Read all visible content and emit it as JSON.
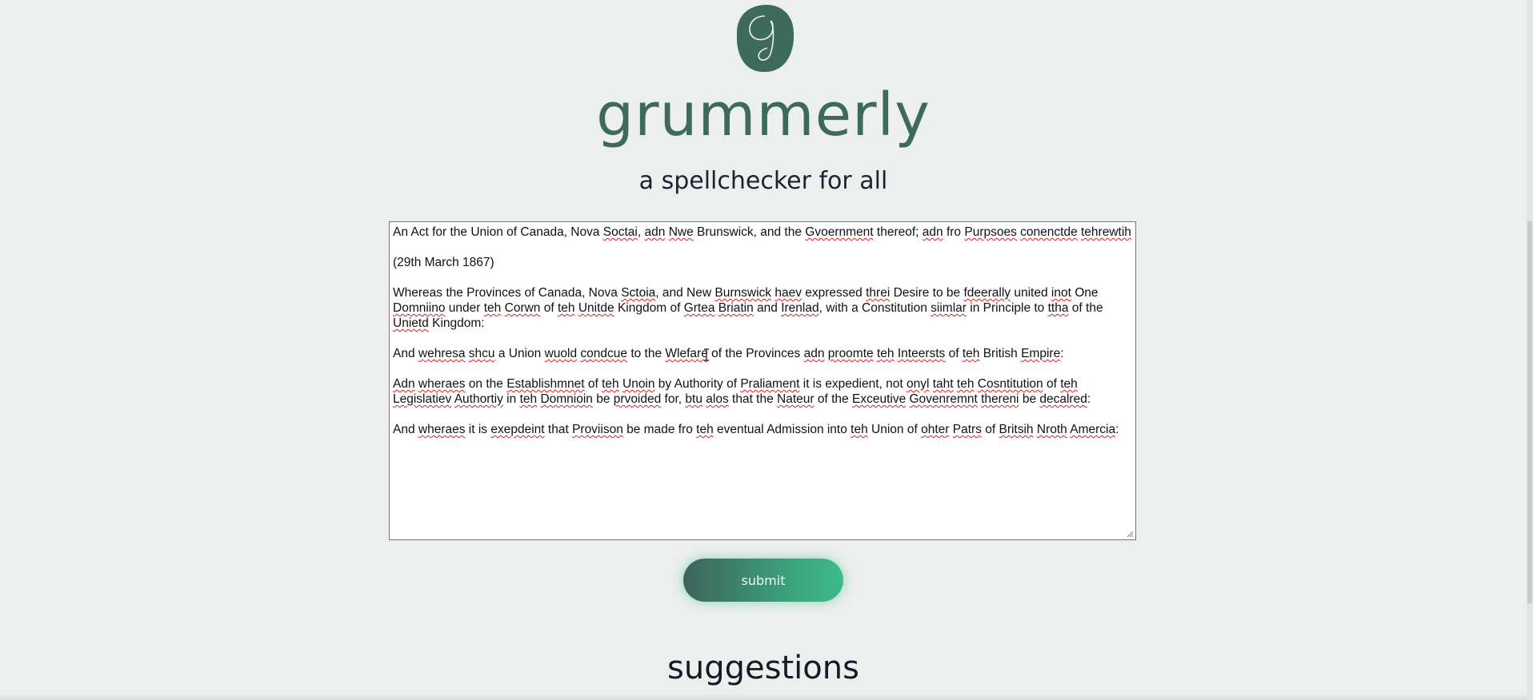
{
  "app": {
    "brand": "grummerly",
    "tagline": "a spellchecker for all",
    "colors": {
      "brand": "#3e6a5c",
      "accent": "#3dba8b",
      "background": "#ecefee",
      "misspelling": "#e01e1e"
    }
  },
  "editor": {
    "paragraphs": [
      [
        {
          "t": "An Act for the Union of Canada, Nova "
        },
        {
          "t": "Soctai",
          "err": true
        },
        {
          "t": ", "
        },
        {
          "t": "adn",
          "err": true
        },
        {
          "t": " "
        },
        {
          "t": "Nwe",
          "err": true
        },
        {
          "t": " Brunswick, and the "
        },
        {
          "t": "Gvoernment",
          "err": true
        },
        {
          "t": " thereof; "
        },
        {
          "t": "adn",
          "err": true
        },
        {
          "t": " fro "
        },
        {
          "t": "Purpsoes",
          "err": true
        },
        {
          "t": " "
        },
        {
          "t": "conenctde",
          "err": true
        },
        {
          "t": " "
        },
        {
          "t": "tehrewtih",
          "err": true
        }
      ],
      [
        {
          "t": "(29th March 1867)"
        }
      ],
      [
        {
          "t": "Whereas the Provinces of Canada, Nova "
        },
        {
          "t": "Sctoia",
          "err": true
        },
        {
          "t": ", and New "
        },
        {
          "t": "Burnswick",
          "err": true
        },
        {
          "t": " "
        },
        {
          "t": "haev",
          "err": true
        },
        {
          "t": " expressed "
        },
        {
          "t": "threi",
          "err": true
        },
        {
          "t": " Desire to be "
        },
        {
          "t": "fdeerally",
          "err": true
        },
        {
          "t": " united "
        },
        {
          "t": "inot",
          "err": true
        },
        {
          "t": " One "
        },
        {
          "t": "Domniino",
          "err": true
        },
        {
          "t": " under "
        },
        {
          "t": "teh",
          "err": true
        },
        {
          "t": " "
        },
        {
          "t": "Corwn",
          "err": true
        },
        {
          "t": " of "
        },
        {
          "t": "teh",
          "err": true
        },
        {
          "t": " "
        },
        {
          "t": "Unitde",
          "err": true
        },
        {
          "t": " Kingdom of "
        },
        {
          "t": "Grtea",
          "err": true
        },
        {
          "t": " "
        },
        {
          "t": "Briatin",
          "err": true
        },
        {
          "t": " and "
        },
        {
          "t": "Irenlad",
          "err": true
        },
        {
          "t": ", with a Constitution "
        },
        {
          "t": "siimlar",
          "err": true
        },
        {
          "t": " in Principle to "
        },
        {
          "t": "ttha",
          "err": true
        },
        {
          "t": " of the "
        },
        {
          "t": "Unietd",
          "err": true
        },
        {
          "t": " Kingdom:"
        }
      ],
      [
        {
          "t": "And "
        },
        {
          "t": "wehresa",
          "err": true
        },
        {
          "t": " "
        },
        {
          "t": "shcu",
          "err": true
        },
        {
          "t": " a Union "
        },
        {
          "t": "wuold",
          "err": true
        },
        {
          "t": " "
        },
        {
          "t": "condcue",
          "err": true
        },
        {
          "t": " to the "
        },
        {
          "t": "Wlefare",
          "err": true
        },
        {
          "t": " of the Provinces "
        },
        {
          "t": "adn",
          "err": true
        },
        {
          "t": " "
        },
        {
          "t": "proomte",
          "err": true
        },
        {
          "t": " "
        },
        {
          "t": "teh",
          "err": true
        },
        {
          "t": " "
        },
        {
          "t": "Inteersts",
          "err": true
        },
        {
          "t": " of "
        },
        {
          "t": "teh",
          "err": true
        },
        {
          "t": " British "
        },
        {
          "t": "Empire",
          "err": true
        },
        {
          "t": ":"
        }
      ],
      [
        {
          "t": "Adn",
          "err": true
        },
        {
          "t": " "
        },
        {
          "t": "wheraes",
          "err": true
        },
        {
          "t": " on the "
        },
        {
          "t": "Establishmnet",
          "err": true
        },
        {
          "t": " of "
        },
        {
          "t": "teh",
          "err": true
        },
        {
          "t": " "
        },
        {
          "t": "Unoin",
          "err": true
        },
        {
          "t": " by Authority of "
        },
        {
          "t": "Praliament",
          "err": true
        },
        {
          "t": " it is expedient, not "
        },
        {
          "t": "onyl",
          "err": true
        },
        {
          "t": " "
        },
        {
          "t": "taht",
          "err": true
        },
        {
          "t": " "
        },
        {
          "t": "teh",
          "err": true
        },
        {
          "t": " "
        },
        {
          "t": "Cosntitution",
          "err": true
        },
        {
          "t": " of "
        },
        {
          "t": "teh",
          "err": true
        },
        {
          "t": " "
        },
        {
          "t": "Legislatiev",
          "err": true
        },
        {
          "t": " "
        },
        {
          "t": "Authortiy",
          "err": true
        },
        {
          "t": " in "
        },
        {
          "t": "teh",
          "err": true
        },
        {
          "t": " "
        },
        {
          "t": "Domnioin",
          "err": true
        },
        {
          "t": " be "
        },
        {
          "t": "prvoided",
          "err": true
        },
        {
          "t": " for, "
        },
        {
          "t": "btu",
          "err": true
        },
        {
          "t": " "
        },
        {
          "t": "alos",
          "err": true
        },
        {
          "t": " that the "
        },
        {
          "t": "Nateur",
          "err": true
        },
        {
          "t": " of the "
        },
        {
          "t": "Exceutive",
          "err": true
        },
        {
          "t": " "
        },
        {
          "t": "Govenremnt",
          "err": true
        },
        {
          "t": " "
        },
        {
          "t": "thereni",
          "err": true
        },
        {
          "t": " be "
        },
        {
          "t": "decalred",
          "err": true
        },
        {
          "t": ":"
        }
      ],
      [
        {
          "t": "And "
        },
        {
          "t": "wheraes",
          "err": true
        },
        {
          "t": " it is "
        },
        {
          "t": "exepdeint",
          "err": true
        },
        {
          "t": " that "
        },
        {
          "t": "Proviison",
          "err": true
        },
        {
          "t": " be made fro "
        },
        {
          "t": "teh",
          "err": true
        },
        {
          "t": " eventual Admission into "
        },
        {
          "t": "teh",
          "err": true
        },
        {
          "t": " Union of "
        },
        {
          "t": "ohter",
          "err": true
        },
        {
          "t": " "
        },
        {
          "t": "Patrs",
          "err": true
        },
        {
          "t": " of "
        },
        {
          "t": "Britsih",
          "err": true
        },
        {
          "t": " "
        },
        {
          "t": "Nroth",
          "err": true
        },
        {
          "t": " "
        },
        {
          "t": "Amercia",
          "err": true
        },
        {
          "t": ":"
        }
      ]
    ]
  },
  "actions": {
    "submit_label": "submit"
  },
  "results": {
    "heading": "suggestions"
  },
  "icons": {
    "logo": "grummerly-logo-icon",
    "resize": "resize-handle-icon",
    "cursor": "text-cursor-icon"
  }
}
